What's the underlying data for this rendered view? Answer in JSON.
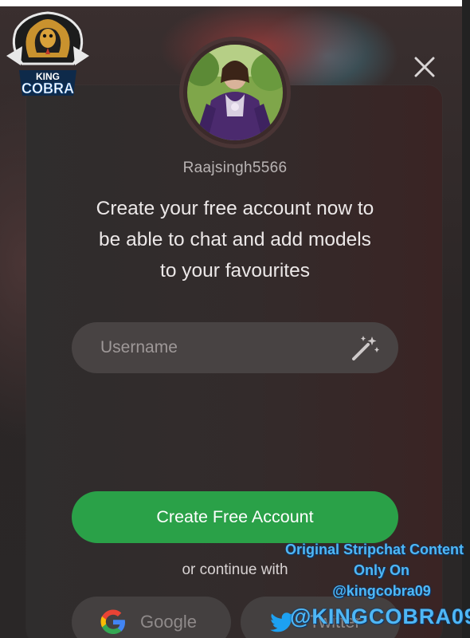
{
  "modal": {
    "close_icon": "close-icon",
    "username_display": "Raajsingh5566",
    "headline_line1": "Create your free account now to",
    "headline_line2": "be able to chat and add models",
    "headline_line3": "to your favourites",
    "username_input": {
      "placeholder": "Username",
      "value": ""
    },
    "wand_icon": "magic-wand-icon",
    "create_button_label": "Create Free Account",
    "continue_label": "or continue with",
    "social": [
      {
        "label": "Google",
        "icon": "google-icon"
      },
      {
        "label": "Twitter",
        "icon": "twitter-icon"
      }
    ]
  },
  "colors": {
    "accent_green": "#2aa148",
    "watermark_blue": "#4fb7f5"
  },
  "logo": {
    "line1": "KING",
    "line2": "COBRA"
  },
  "watermark": {
    "line1": "Original Stripchat Content",
    "line2": "Only On",
    "line3": "@kingcobra09",
    "handle": "@KINGCOBRA09"
  }
}
